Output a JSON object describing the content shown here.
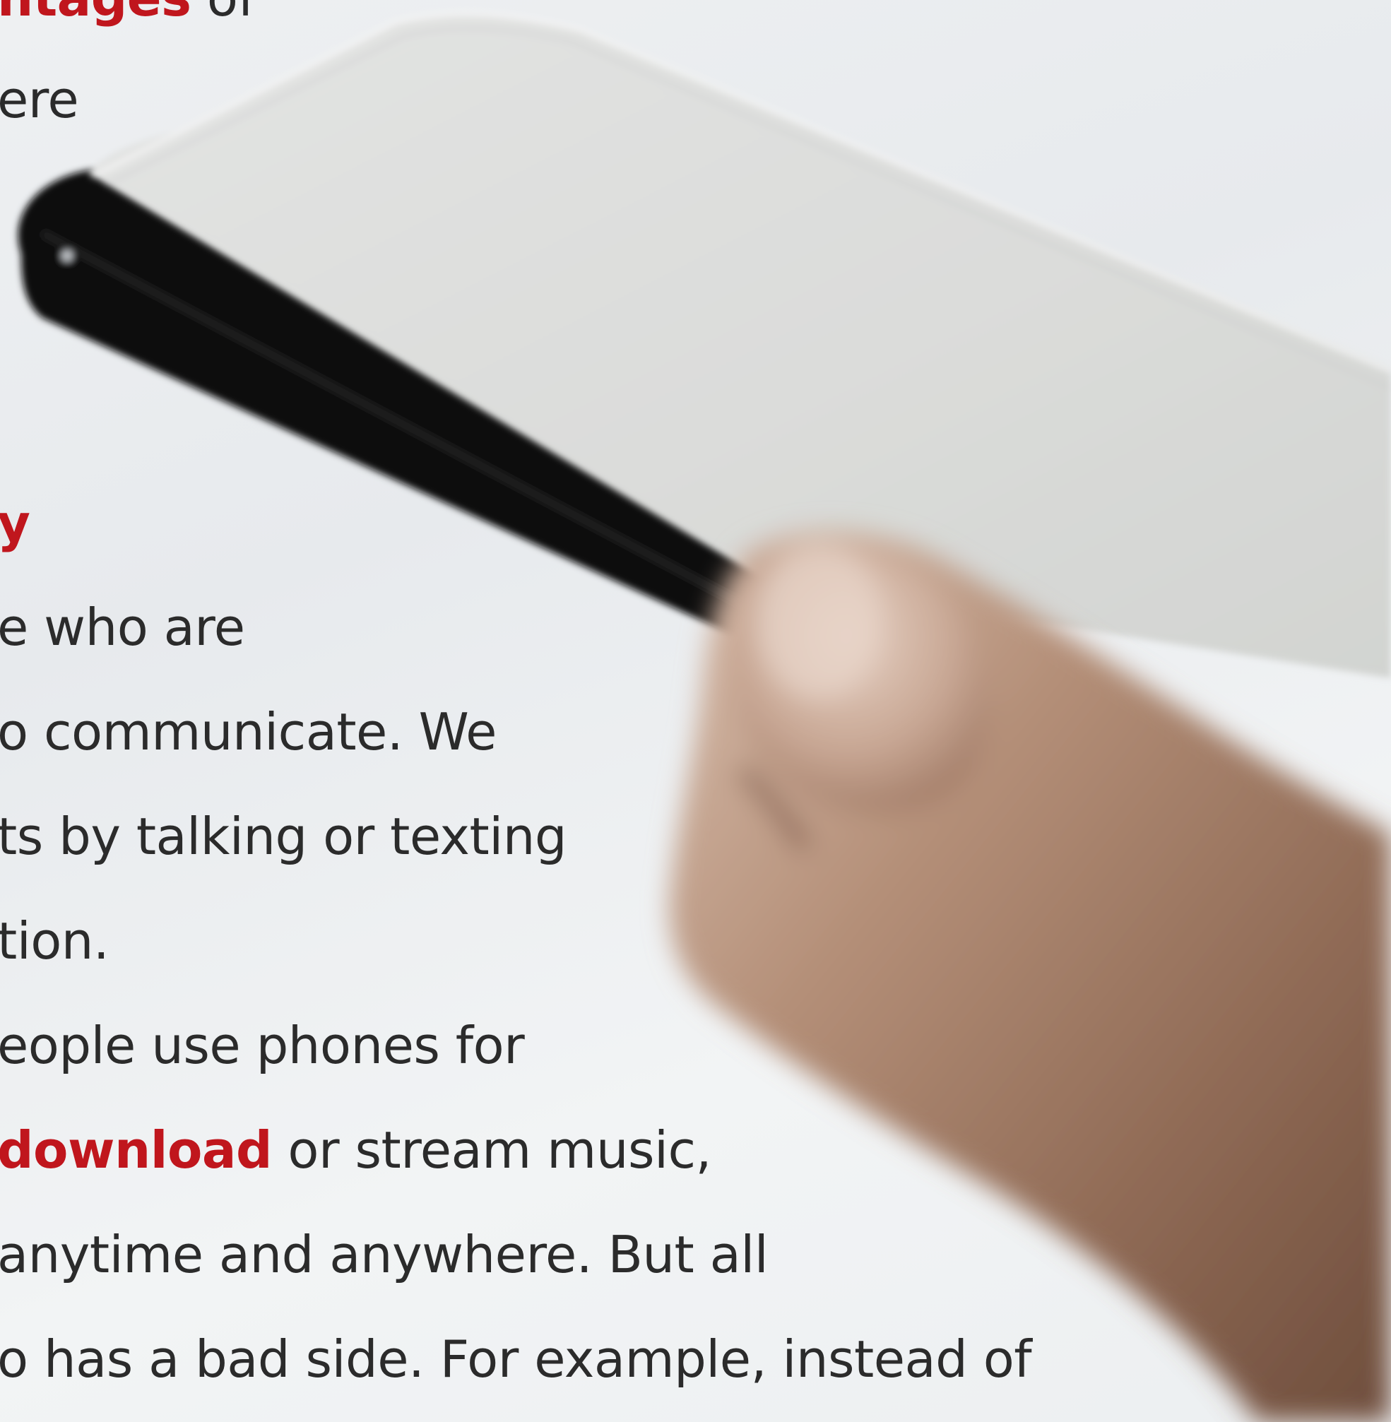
{
  "text": {
    "heading_fragment_top": "ntages",
    "line_1_tail": " of",
    "line_2": "ere",
    "heading_fragment_2": "y",
    "line_3": "e who are",
    "line_4": "o communicate. We",
    "line_5": "ts by talking or texting",
    "line_6": "tion.",
    "line_7": "eople use phones for",
    "line_8_red": "download",
    "line_8_rest": " or stream music,",
    "line_9": "anytime and anywhere. But all",
    "line_10": "o has a bad side. For example, instead of"
  },
  "colors": {
    "body_text": "#2b2b2b",
    "highlight": "#c0161d",
    "background": "#eceff1",
    "phone_body": "#0e0e0f",
    "skin": "#a27c65"
  },
  "photo": {
    "subject": "hand holding smartphone",
    "icons": [
      "phone-image",
      "hand-image"
    ]
  }
}
